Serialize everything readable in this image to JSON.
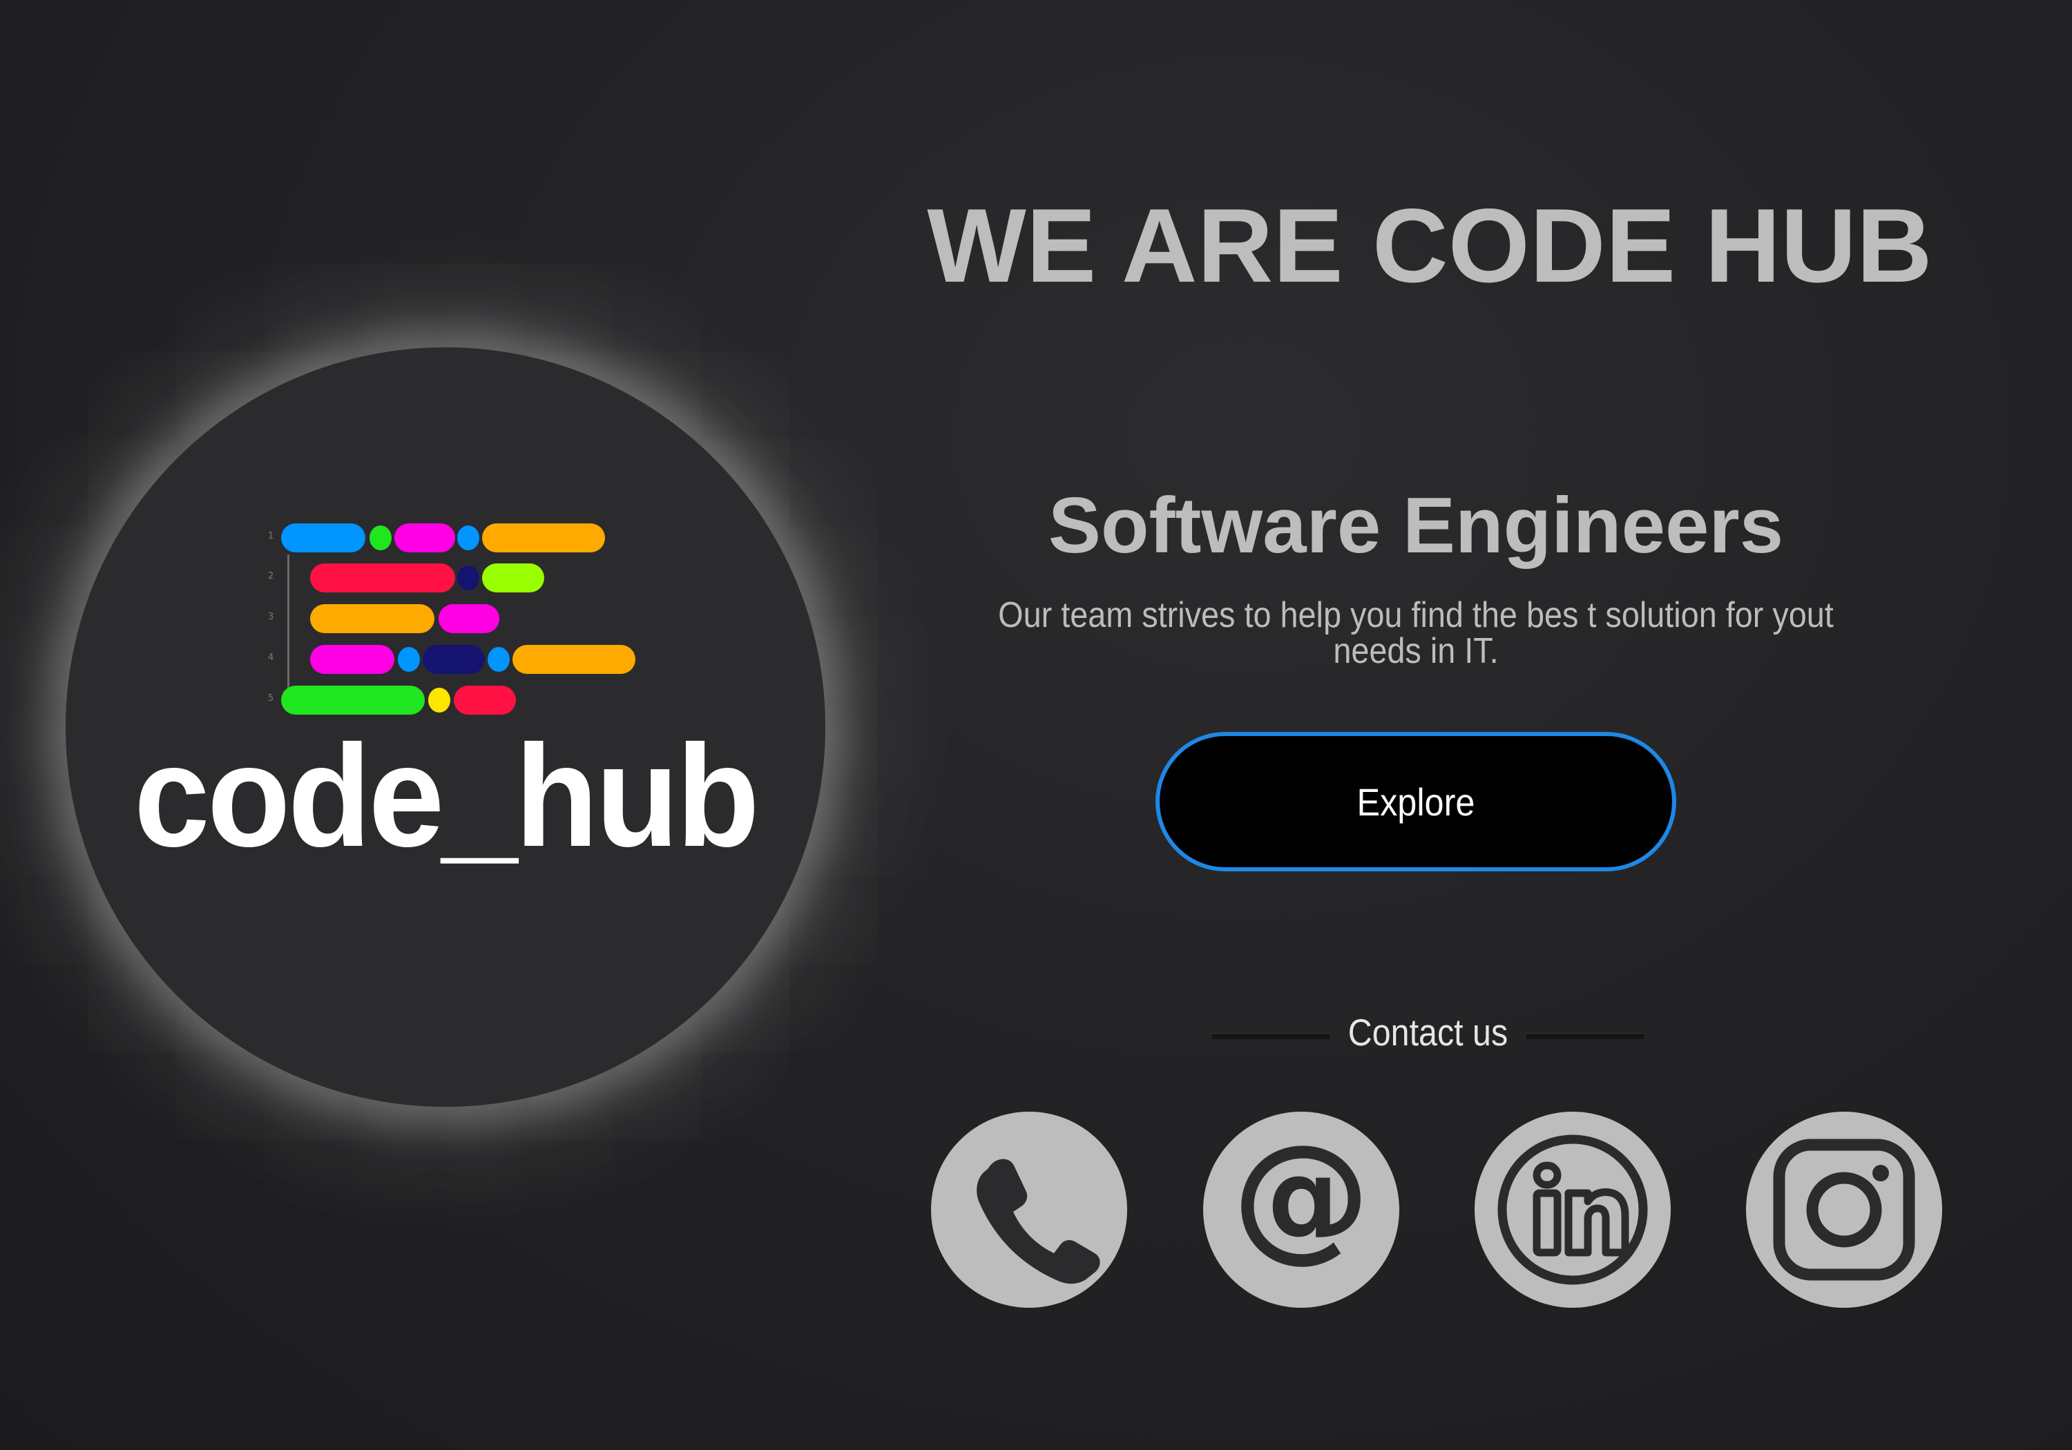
{
  "logo": {
    "wordmark": "code_hub",
    "line_numbers": [
      "1",
      "2",
      "3",
      "4",
      "5"
    ],
    "icon": "code-lines-logo-icon"
  },
  "hero": {
    "headline": "WE ARE CODE HUB",
    "subtitle": "Software Engineers",
    "tagline": "Our team strives to help you find the bes t solution for yout needs in IT.",
    "explore_label": "Explore"
  },
  "contact": {
    "label": "Contact us",
    "links": [
      {
        "icon": "phone-icon"
      },
      {
        "icon": "at-sign-icon"
      },
      {
        "icon": "linkedin-icon"
      },
      {
        "icon": "instagram-icon"
      }
    ]
  },
  "colors": {
    "accent_border": "#1e88e5",
    "heading_text": "#bdbdbd",
    "icon_circle": "#bdbdbd",
    "icon_glyph": "#2b2b2d",
    "button_fill": "#000000"
  }
}
